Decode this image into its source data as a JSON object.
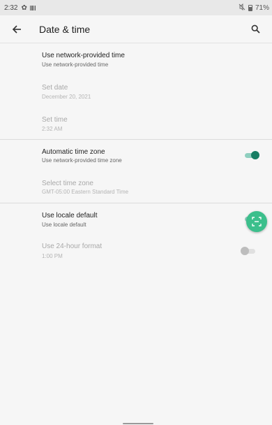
{
  "status_bar": {
    "time": "2:32",
    "battery": "71%",
    "icons": [
      "gear-icon",
      "sim-icon",
      "mute-icon",
      "battery-icon"
    ]
  },
  "app_bar": {
    "title": "Date & time",
    "back_icon": "arrow-left-icon",
    "search_icon": "search-icon"
  },
  "settings": [
    {
      "title": "Use network-provided time",
      "summary": "Use network-provided time",
      "enabled": true
    },
    {
      "title": "Set date",
      "summary": "December 20, 2021",
      "enabled": false
    },
    {
      "title": "Set time",
      "summary": "2:32 AM",
      "enabled": false
    },
    {
      "title": "Automatic time zone",
      "summary": "Use network-provided time zone",
      "enabled": true,
      "toggle": "on"
    },
    {
      "title": "Select time zone",
      "summary": "GMT-05:00 Eastern Standard Time",
      "enabled": false
    },
    {
      "title": "Use locale default",
      "summary": "Use locale default",
      "enabled": true,
      "toggle": "on"
    },
    {
      "title": "Use 24-hour format",
      "summary": "1:00 PM",
      "enabled": false,
      "toggle": "off"
    }
  ],
  "fab": {
    "icon": "screenshot-scan-icon"
  },
  "colors": {
    "accent": "#177d63",
    "accent_track": "#8fcfbf",
    "fab": "#3cbf8c",
    "background": "#f6f6f6"
  }
}
